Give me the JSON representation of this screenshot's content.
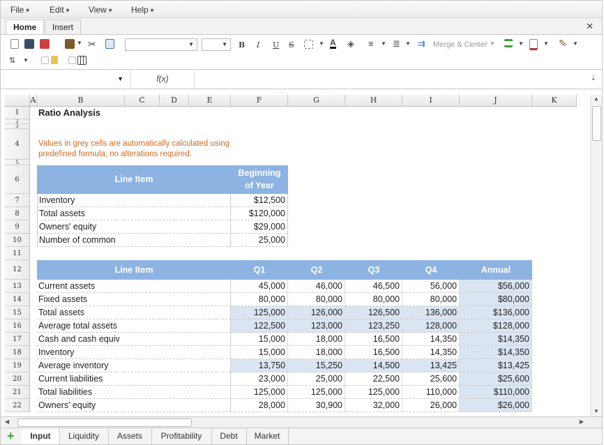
{
  "menu": [
    "File",
    "Edit",
    "View",
    "Help"
  ],
  "ribbon": {
    "tabs": [
      "Home",
      "Insert"
    ],
    "active_tab": "Home",
    "close": "✕",
    "merge_label": "Merge & Center"
  },
  "formula_bar": {
    "fx_label": "f(x)",
    "name_box": "",
    "value": ""
  },
  "columns": [
    "A",
    "B",
    "C",
    "D",
    "E",
    "F",
    "G",
    "H",
    "I",
    "J",
    "K"
  ],
  "rows": [
    "1",
    "2",
    "3",
    "4",
    "5",
    "6",
    "7",
    "8",
    "9",
    "10",
    "11",
    "12",
    "13",
    "14",
    "15",
    "16",
    "17",
    "18",
    "19",
    "20",
    "21",
    "22"
  ],
  "sheet": {
    "title": "Ratio Analysis",
    "note": [
      "Values in grey cells are automatically calculated using",
      "predefined formula, no alterations required."
    ],
    "table1": {
      "headers": [
        "Line Item",
        "Beginning of Year"
      ],
      "header_lines": [
        "Beginning",
        "of Year"
      ],
      "rows": [
        [
          "Inventory",
          "$12,500"
        ],
        [
          "Total assets",
          "$120,000"
        ],
        [
          "Owners' equity",
          "$29,000"
        ],
        [
          "Number of common",
          "25,000"
        ]
      ]
    },
    "table2": {
      "headers": [
        "Line Item",
        "Q1",
        "Q2",
        "Q3",
        "Q4",
        "Annual"
      ],
      "rows": [
        {
          "label": "Current assets",
          "values": [
            "45,000",
            "46,000",
            "46,500",
            "56,000",
            "$56,000"
          ],
          "calc": false
        },
        {
          "label": "Fixed assets",
          "values": [
            "80,000",
            "80,000",
            "80,000",
            "80,000",
            "$80,000"
          ],
          "calc": false
        },
        {
          "label": "Total assets",
          "values": [
            "125,000",
            "126,000",
            "126,500",
            "136,000",
            "$136,000"
          ],
          "calc": true
        },
        {
          "label": "Average total assets",
          "values": [
            "122,500",
            "123,000",
            "123,250",
            "128,000",
            "$128,000"
          ],
          "calc": true
        },
        {
          "label": "Cash and cash equiv",
          "values": [
            "15,000",
            "18,000",
            "16,500",
            "14,350",
            "$14,350"
          ],
          "calc": false
        },
        {
          "label": "Inventory",
          "values": [
            "15,000",
            "18,000",
            "16,500",
            "14,350",
            "$14,350"
          ],
          "calc": false
        },
        {
          "label": "Average inventory",
          "values": [
            "13,750",
            "15,250",
            "14,500",
            "13,425",
            "$13,425"
          ],
          "calc": true
        },
        {
          "label": "Current liabilities",
          "values": [
            "23,000",
            "25,000",
            "22,500",
            "25,600",
            "$25,600"
          ],
          "calc": false
        },
        {
          "label": "Total liabilities",
          "values": [
            "125,000",
            "125,000",
            "125,000",
            "110,000",
            "$110,000"
          ],
          "calc": false
        },
        {
          "label": "Owners' equity",
          "values": [
            "28,000",
            "30,900",
            "32,000",
            "26,000",
            "$26,000"
          ],
          "calc": false
        }
      ]
    }
  },
  "sheet_tabs": [
    "Input",
    "Liquidity",
    "Assets",
    "Profitability",
    "Debt",
    "Market"
  ],
  "active_sheet": "Input",
  "colors": {
    "header_fill": "#8db3e2",
    "calc_fill": "#dbe5f1",
    "note_text": "#d06a1e",
    "grid_line": "#d8d8d8"
  }
}
